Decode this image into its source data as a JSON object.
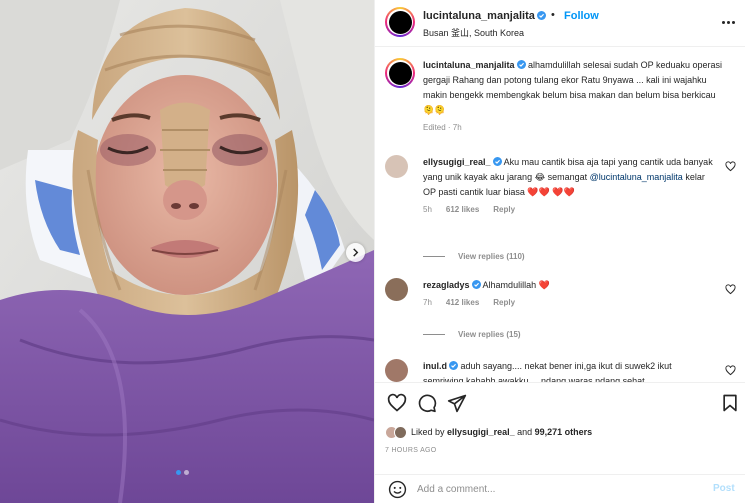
{
  "header": {
    "username": "lucintaluna_manjalita",
    "separator": "•",
    "follow_label": "Follow",
    "location": "Busan 釜山, South Korea"
  },
  "caption": {
    "username": "lucintaluna_manjalita",
    "text": "alhamdulillah selesai sudah OP keduaku operasi gergaji Rahang dan potong tulang ekor Ratu 9nyawa ... kali ini wajahku makin bengekk membengkak belum bisa makan dan belum bisa berkicau 🫠🫠",
    "edited": "Edited · 7h"
  },
  "comments": [
    {
      "username": "ellysugigi_real_",
      "text_before": "Aku mau cantik bisa aja tapi yang cantik uda banyak yang unik kayak aku jarang 😂 semangat",
      "mention": "@lucintaluna_manjalita",
      "text_after": "kelar OP pasti cantik luar biasa",
      "hearts": "❤️❤️ ❤️❤️",
      "time": "5h",
      "likes": "612 likes",
      "reply_label": "Reply",
      "view_replies": "View replies (110)"
    },
    {
      "username": "rezagladys",
      "text_before": "Alhamdulillah",
      "hearts": "❤️",
      "time": "7h",
      "likes": "412 likes",
      "reply_label": "Reply",
      "view_replies": "View replies (15)"
    },
    {
      "username": "inul.d",
      "text_before": "aduh sayang.... nekat bener ini,ga ikut di suwek2 ikut semriwing kababh awakku ... ndang waras ndang sehat"
    }
  ],
  "likes": {
    "prefix": "Liked by",
    "user": "ellysugigi_real_",
    "middle": "and",
    "count": "99,271 others"
  },
  "timestamp": "7 HOURS AGO",
  "add_comment": {
    "placeholder": "Add a comment...",
    "post_label": "Post"
  },
  "colors": {
    "link_blue": "#0095f6",
    "heart_red": "#ed4956",
    "verified_blue": "#3897f0",
    "muted": "#8e8e8e"
  },
  "carousel": {
    "current": 1,
    "total": 2
  }
}
